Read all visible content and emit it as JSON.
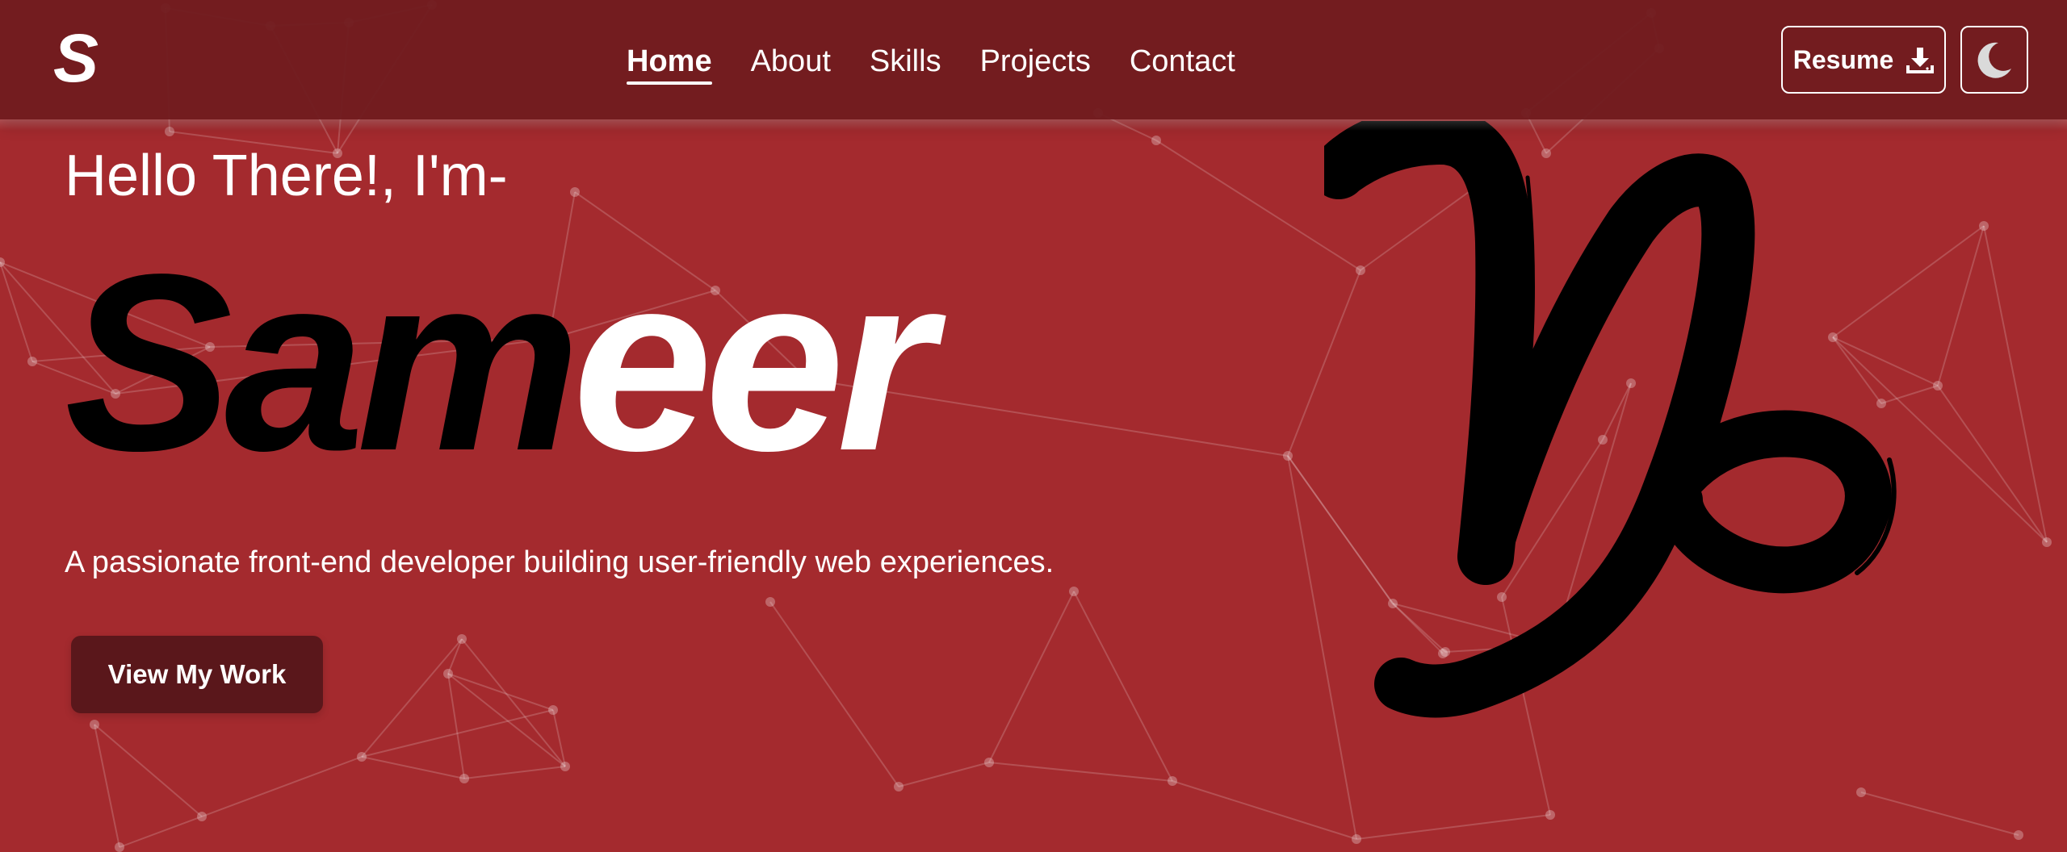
{
  "colors": {
    "background": "#a42a2e",
    "navbar": "#701c1f",
    "cta_button": "#5a171b",
    "text": "#ffffff",
    "name_dark": "#000000"
  },
  "navbar": {
    "logo": "S",
    "links": [
      {
        "label": "Home",
        "active": true
      },
      {
        "label": "About",
        "active": false
      },
      {
        "label": "Skills",
        "active": false
      },
      {
        "label": "Projects",
        "active": false
      },
      {
        "label": "Contact",
        "active": false
      }
    ],
    "resume_label": "Resume",
    "resume_icon": "download-icon",
    "theme_icon": "moon-icon"
  },
  "hero": {
    "greeting": "Hello There!, I'm-",
    "name_dark": "Sam",
    "name_light": "eer",
    "tagline": "A passionate front-end developer building user-friendly web experiences.",
    "cta_label": "View My Work",
    "symbol_icon": "capricorn-symbol-icon"
  }
}
